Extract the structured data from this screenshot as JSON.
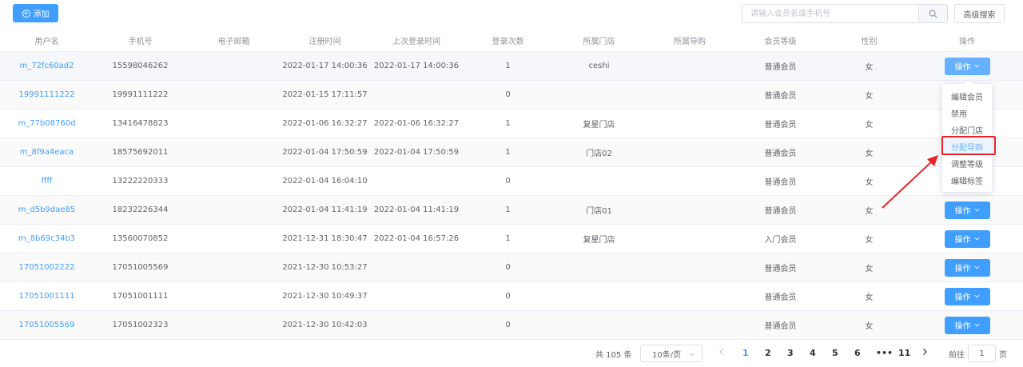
{
  "toolbar": {
    "add_label": "添加",
    "search_placeholder": "请输入会员名或手机号",
    "advanced_label": "高级搜索"
  },
  "colors": {
    "primary": "#409eff",
    "primary_light": "#66b1ff",
    "highlight_box": "#e8232a"
  },
  "table": {
    "headers": [
      "用户名",
      "手机号",
      "电子邮箱",
      "注册时间",
      "上次登录时间",
      "登录次数",
      "所属门店",
      "所属导购",
      "会员等级",
      "性别",
      "操作"
    ],
    "op_label": "操作",
    "rows": [
      {
        "user": "m_72fc60ad2",
        "phone": "15598046262",
        "email": "",
        "reg": "2022-01-17 14:00:36",
        "last": "2022-01-17 14:00:36",
        "count": "1",
        "store": "ceshi",
        "guide": "",
        "level": "普通会员",
        "gender": "女"
      },
      {
        "user": "19991111222",
        "phone": "19991111222",
        "email": "",
        "reg": "2022-01-15 17:11:57",
        "last": "",
        "count": "0",
        "store": "",
        "guide": "",
        "level": "普通会员",
        "gender": "女"
      },
      {
        "user": "m_77b08760d",
        "phone": "13416478823",
        "email": "",
        "reg": "2022-01-06 16:32:27",
        "last": "2022-01-06 16:32:27",
        "count": "1",
        "store": "复星门店",
        "guide": "",
        "level": "普通会员",
        "gender": "女"
      },
      {
        "user": "m_8f9a4eaca",
        "phone": "18575692011",
        "email": "",
        "reg": "2022-01-04 17:50:59",
        "last": "2022-01-04 17:50:59",
        "count": "1",
        "store": "门店02",
        "guide": "",
        "level": "普通会员",
        "gender": "女"
      },
      {
        "user": "ffff",
        "phone": "13222220333",
        "email": "",
        "reg": "2022-01-04 16:04:10",
        "last": "",
        "count": "0",
        "store": "",
        "guide": "",
        "level": "普通会员",
        "gender": "女"
      },
      {
        "user": "m_d5b9dae85",
        "phone": "18232226344",
        "email": "",
        "reg": "2022-01-04 11:41:19",
        "last": "2022-01-04 11:41:19",
        "count": "1",
        "store": "门店01",
        "guide": "",
        "level": "普通会员",
        "gender": "女"
      },
      {
        "user": "m_8b69c34b3",
        "phone": "13560070852",
        "email": "",
        "reg": "2021-12-31 18:30:47",
        "last": "2022-01-04 16:57:26",
        "count": "1",
        "store": "复星门店",
        "guide": "",
        "level": "入门会员",
        "gender": "女"
      },
      {
        "user": "17051002222",
        "phone": "17051005569",
        "email": "",
        "reg": "2021-12-30 10:53:27",
        "last": "",
        "count": "0",
        "store": "",
        "guide": "",
        "level": "普通会员",
        "gender": "女"
      },
      {
        "user": "17051001111",
        "phone": "17051001111",
        "email": "",
        "reg": "2021-12-30 10:49:37",
        "last": "",
        "count": "0",
        "store": "",
        "guide": "",
        "level": "普通会员",
        "gender": "女"
      },
      {
        "user": "17051005569",
        "phone": "17051002323",
        "email": "",
        "reg": "2021-12-30 10:42:03",
        "last": "",
        "count": "0",
        "store": "",
        "guide": "",
        "level": "普通会员",
        "gender": "女"
      }
    ]
  },
  "dropdown": {
    "items": [
      "编辑会员",
      "禁用",
      "分配门店",
      "分配导购",
      "调整等级",
      "编辑标签"
    ],
    "highlighted": "分配导购"
  },
  "pagination": {
    "total_text": "共 105 条",
    "page_size": "10条/页",
    "pages": [
      "1",
      "2",
      "3",
      "4",
      "5",
      "6",
      "•••",
      "11"
    ],
    "current": "1",
    "goto_label": "前往",
    "goto_value": "1",
    "goto_suffix": "页"
  }
}
